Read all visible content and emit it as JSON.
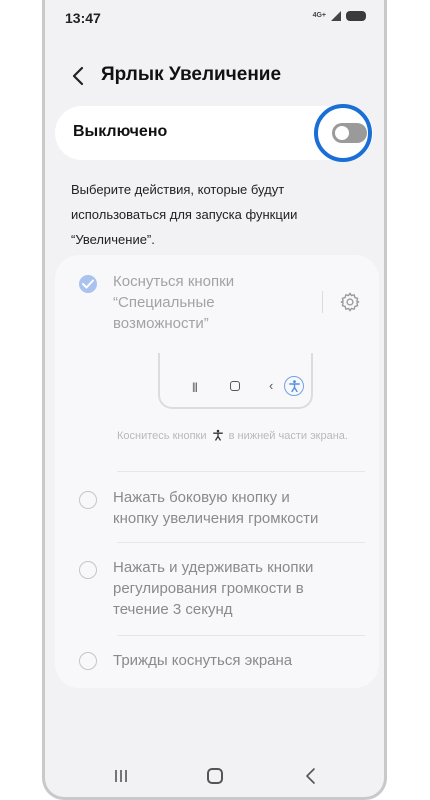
{
  "status_bar": {
    "time": "13:47",
    "network": "4G+",
    "icons": [
      "signal-icon",
      "battery-icon"
    ]
  },
  "header": {
    "title": "Ярлык Увеличение",
    "back_icon": "back-icon"
  },
  "toggle": {
    "label": "Выключено",
    "state": "off"
  },
  "description": "Выберите действия, которые будут использоваться для запуска функции “Увеличение”.",
  "options": [
    {
      "label_lines": [
        "Коснуться кнопки",
        "“Специальные",
        "возможности”"
      ],
      "checked": true,
      "has_settings": true,
      "hint_before": "Коснитесь кнопки",
      "hint_after": "в нижней части экрана."
    },
    {
      "label_lines": [
        "Нажать боковую кнопку и",
        "кнопку увеличения громкости"
      ],
      "checked": false
    },
    {
      "label_lines": [
        "Нажать и удерживать кнопки",
        "регулирования громкости в",
        "течение 3 секунд"
      ],
      "checked": false
    },
    {
      "label_lines": [
        "Трижды коснуться экрана"
      ],
      "checked": false
    }
  ],
  "colors": {
    "accent": "#1a6fd6",
    "checked_radio": "#a9c3ee",
    "background": "#f2f2f4",
    "card": "#ffffff"
  },
  "navigation_bar": {
    "icons": [
      "recent-apps-icon",
      "home-icon",
      "back-icon"
    ]
  }
}
